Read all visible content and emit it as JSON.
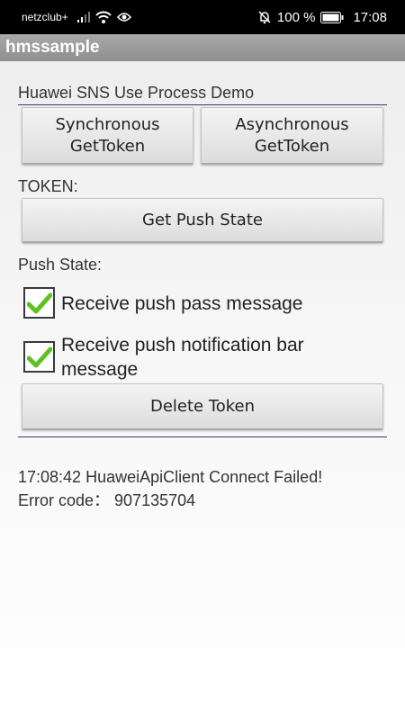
{
  "status_bar": {
    "carrier": "netzclub+",
    "battery_percent": "100 %",
    "time": "17:08",
    "icons": [
      "signal-icon",
      "wifi-icon",
      "eye-icon",
      "mute-icon",
      "battery-icon"
    ]
  },
  "app_bar": {
    "title": "hmssample"
  },
  "main": {
    "section_title": "Huawei SNS Use Process Demo",
    "sync_button": "Synchronous GetToken",
    "async_button": "Asynchronous GetToken",
    "token_label": "TOKEN:",
    "push_state_button": "Get Push State",
    "push_state_label": "Push State:",
    "checkboxes": [
      {
        "label": "Receive push pass message",
        "checked": true
      },
      {
        "label": "Receive push notification bar message",
        "checked": true
      }
    ],
    "delete_button": "Delete Token",
    "log_line1": "17:08:42 HuaweiApiClient Connect Failed!",
    "log_line2": "Error code： 907135704"
  },
  "colors": {
    "app_bar": "#999999",
    "divider": "#2e3a7a",
    "check": "#5dc21e"
  }
}
